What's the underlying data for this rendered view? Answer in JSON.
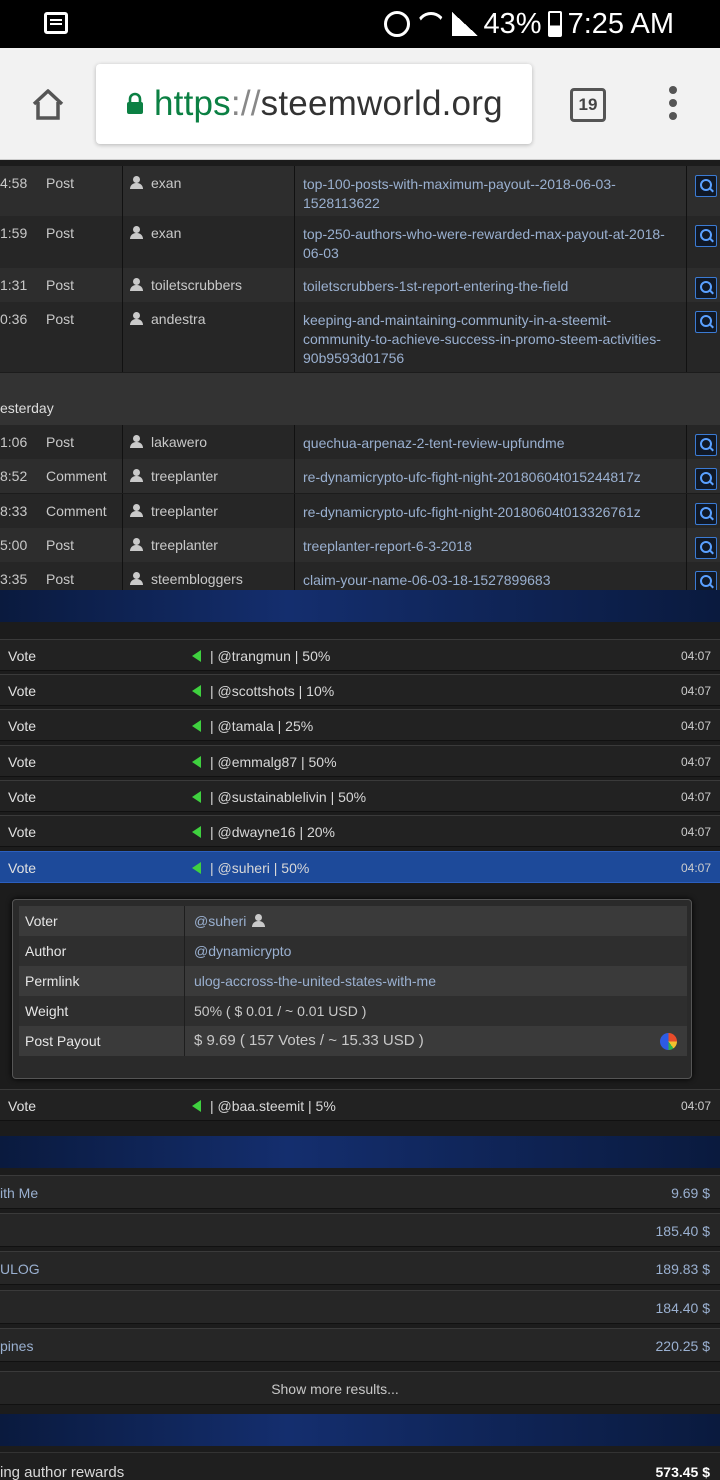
{
  "status": {
    "battery": "43%",
    "time": "7:25 AM"
  },
  "browser": {
    "scheme": "https",
    "separator": "://",
    "host": "steemworld.org",
    "tab_count": "19"
  },
  "posts": [
    {
      "time": "4:58",
      "type": "Post",
      "author": "exan",
      "permlink": "top-100-posts-with-maximum-payout--2018-06-03-1528113622"
    },
    {
      "time": "1:59",
      "type": "Post",
      "author": "exan",
      "permlink": "top-250-authors-who-were-rewarded-max-payout-at-2018-06-03"
    },
    {
      "time": "1:31",
      "type": "Post",
      "author": "toiletscrubbers",
      "permlink": "toiletscrubbers-1st-report-entering-the-field"
    },
    {
      "time": "0:36",
      "type": "Post",
      "author": "andestra",
      "permlink": "keeping-and-maintaining-community-in-a-steemit-community-to-achieve-success-in-promo-steem-activities-90b9593d01756"
    }
  ],
  "day_header": "esterday",
  "posts_yesterday": [
    {
      "time": "1:06",
      "type": "Post",
      "author": "lakawero",
      "permlink": "quechua-arpenaz-2-tent-review-upfundme"
    },
    {
      "time": "8:52",
      "type": "Comment",
      "author": "treeplanter",
      "permlink": "re-dynamicrypto-ufc-fight-night-20180604t015244817z"
    },
    {
      "time": "8:33",
      "type": "Comment",
      "author": "treeplanter",
      "permlink": "re-dynamicrypto-ufc-fight-night-20180604t013326761z"
    },
    {
      "time": "5:00",
      "type": "Post",
      "author": "treeplanter",
      "permlink": "treeplanter-report-6-3-2018"
    },
    {
      "time": "3:35",
      "type": "Post",
      "author": "steembloggers",
      "permlink": "claim-your-name-06-03-18-1527899683"
    }
  ],
  "votes": [
    {
      "label": "Vote",
      "value": "| @trangmun | 50%",
      "time": "04:07"
    },
    {
      "label": "Vote",
      "value": "| @scottshots | 10%",
      "time": "04:07"
    },
    {
      "label": "Vote",
      "value": "| @tamala | 25%",
      "time": "04:07"
    },
    {
      "label": "Vote",
      "value": "| @emmalg87 | 50%",
      "time": "04:07"
    },
    {
      "label": "Vote",
      "value": "| @sustainablelivin | 50%",
      "time": "04:07"
    },
    {
      "label": "Vote",
      "value": "| @dwayne16 | 20%",
      "time": "04:07"
    },
    {
      "label": "Vote",
      "value": "| @suheri | 50%",
      "time": "04:07"
    },
    {
      "label": "Vote",
      "value": "| @baa.steemit | 5%",
      "time": "04:07"
    }
  ],
  "vote_detail": {
    "voter_k": "Voter",
    "voter_v": "@suheri",
    "author_k": "Author",
    "author_v": "@dynamicrypto",
    "permlink_k": "Permlink",
    "permlink_v": "ulog-accross-the-united-states-with-me",
    "weight_k": "Weight",
    "weight_v": "50% ( $ 0.01 / ~ 0.01 USD )",
    "payout_k": "Post Payout",
    "payout_v": "$ 9.69 ( 157 Votes / ~ 15.33 USD )"
  },
  "earnings": [
    {
      "name": "ith Me",
      "amount": "9.69 $"
    },
    {
      "name": "",
      "amount": "185.40 $"
    },
    {
      "name": "ULOG",
      "amount": "189.83 $"
    },
    {
      "name": "",
      "amount": "184.40 $"
    },
    {
      "name": "pines",
      "amount": "220.25 $"
    }
  ],
  "show_more": "Show more results...",
  "total": {
    "label": "ing author rewards",
    "amount": "573.45 $"
  }
}
